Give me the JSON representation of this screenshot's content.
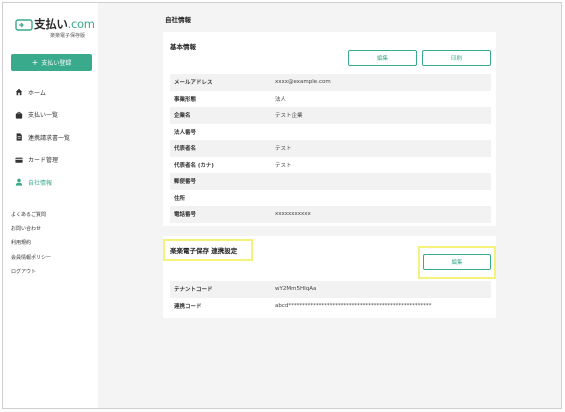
{
  "app": {
    "logo_main": "支払い",
    "logo_accent": ".com",
    "logo_sub": "楽楽電子保存版"
  },
  "sidebar": {
    "register_button": "支払い登録",
    "items": [
      {
        "label": "ホーム",
        "icon": "home-icon"
      },
      {
        "label": "支払い一覧",
        "icon": "bag-icon"
      },
      {
        "label": "連携請求書一覧",
        "icon": "document-icon"
      },
      {
        "label": "カード管理",
        "icon": "card-icon"
      },
      {
        "label": "自社情報",
        "icon": "user-icon",
        "active": true
      }
    ],
    "footer_links": [
      "よくあるご質問",
      "お問い合わせ",
      "利用規約",
      "会員情報ポリシー",
      "ログアウト"
    ]
  },
  "main": {
    "page_title": "自社情報",
    "basic_info": {
      "title": "基本情報",
      "edit_button": "編集",
      "print_button": "印刷",
      "rows": [
        {
          "label": "メールアドレス",
          "value": "xxxx@example.com"
        },
        {
          "label": "事業形態",
          "value": "法人"
        },
        {
          "label": "企業名",
          "value": "テスト企業"
        },
        {
          "label": "法人番号",
          "value": ""
        },
        {
          "label": "代表者名",
          "value": "テスト"
        },
        {
          "label": "代表者名 (カナ)",
          "value": "テスト"
        },
        {
          "label": "郵便番号",
          "value": ""
        },
        {
          "label": "住所",
          "value": ""
        },
        {
          "label": "電話番号",
          "value": "xxxxxxxxxxx"
        }
      ]
    },
    "integration": {
      "title": "楽楽電子保存 連携設定",
      "edit_button": "編集",
      "rows": [
        {
          "label": "テナントコード",
          "value": "wY2Mm5HIqAa"
        },
        {
          "label": "連携コード",
          "value": "abcd****************************************************"
        }
      ]
    }
  },
  "colors": {
    "accent": "#3aaa8c",
    "highlight": "#f4f27a",
    "background": "#f4f4f4"
  }
}
